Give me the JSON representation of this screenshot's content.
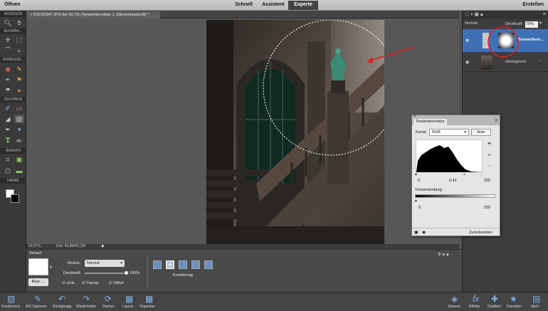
{
  "topbar": {
    "open": "Öffnen",
    "modes": {
      "schnell": "Schnell",
      "assistent": "Assistent",
      "experte": "Experte"
    },
    "create": "Erstellen"
  },
  "toolbox": {
    "sections": {
      "view": "ANZEIGEN",
      "select": "AUSWÄH...",
      "enhance": "VERBESSE...",
      "draw": "ZEICHNEN",
      "modify": "ÄNDERN",
      "color": "FARBE"
    }
  },
  "document": {
    "tab_label": "DSC00347.JPG bei 16,7% (Tonwertkorrektur 1, Ebenenmaske/8) *",
    "status_zoom": "16,67%",
    "status_doc": "Dok: 45,9M/61,2M"
  },
  "tool_options": {
    "tool_name": "Verlauf",
    "edit_button": "Bear. ...",
    "mode_label": "Modus:",
    "mode_value": "Normal",
    "opacity_label": "Deckkraft:",
    "opacity_value": "100%",
    "opacity_fraction": 1.0,
    "reverse_label": "Umk.",
    "transp_label": "Transp.",
    "dither_label": "Dither",
    "gradient_type_label": "Kreisförmig"
  },
  "layers_panel": {
    "blend_mode": "Normal",
    "opacity_label": "Deckkraft:",
    "opacity_value": "76%",
    "layers": [
      {
        "name": "Tonwertkorr..."
      },
      {
        "name": "Hintergrund"
      }
    ]
  },
  "levels_dialog": {
    "tab_title": "Tonwertkorrektur",
    "channel_label": "Kanal:",
    "channel_value": "RGB",
    "auto_button": "Auto",
    "input_black": "0",
    "input_gamma": "0,42",
    "input_white": "255",
    "output_label": "Tonwertumfang:",
    "output_black": "0",
    "output_white": "255",
    "reset_button": "Zurücksetzen"
  },
  "bottombar": {
    "left_items": [
      "Fotobereich",
      "WZ-Optionen",
      "Rückgängig",
      "Wiederholen",
      "Drehen",
      "Layout",
      "Organizer"
    ],
    "right_items": [
      "Ebenen",
      "Effekte",
      "Grafiken",
      "Favoriten",
      "Mehr"
    ]
  },
  "colors": {
    "accent": "#3f6fb5",
    "annotation_red": "#e02020"
  }
}
